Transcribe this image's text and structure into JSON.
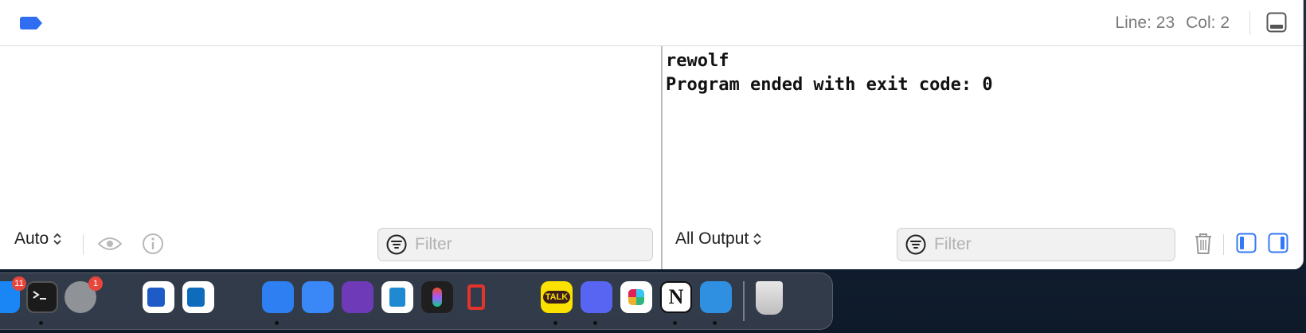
{
  "status": {
    "line": "Line: 23",
    "col": "Col: 2"
  },
  "console": {
    "output": "rewolf\nProgram ended with exit code: 0"
  },
  "variables_panel": {
    "scope_select": "Auto",
    "filter_placeholder": "Filter"
  },
  "console_panel": {
    "output_select": "All Output",
    "filter_placeholder": "Filter"
  },
  "colors": {
    "accent": "#3478f6",
    "tag": "#2f6ef2",
    "badge": "#e8453c"
  },
  "dock": {
    "apps": [
      {
        "name": "app-store",
        "badge": "11"
      },
      {
        "name": "terminal"
      },
      {
        "name": "system-settings",
        "badge": "1"
      },
      {
        "name": "word"
      },
      {
        "name": "outlook"
      },
      {
        "name": "xcode-beta"
      },
      {
        "name": "simulator-beta"
      },
      {
        "name": "github-desktop"
      },
      {
        "name": "vscode"
      },
      {
        "name": "figma"
      },
      {
        "name": "linear"
      },
      {
        "name": "kakaotalk",
        "label": "TALK"
      },
      {
        "name": "discord"
      },
      {
        "name": "slack"
      },
      {
        "name": "notion",
        "label": "N"
      },
      {
        "name": "preview"
      },
      {
        "name": "trash"
      }
    ]
  }
}
